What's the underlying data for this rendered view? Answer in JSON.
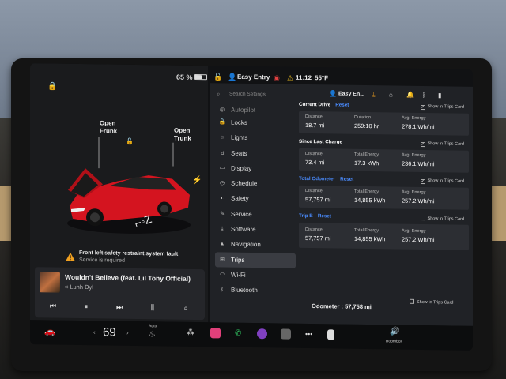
{
  "status": {
    "battery": "65 %",
    "profile": "Easy Entry",
    "time": "11:12",
    "temp": "55°F",
    "profile_short": "Easy En..."
  },
  "car": {
    "open_frunk": [
      "Open",
      "Frunk"
    ],
    "open_trunk": [
      "Open",
      "Trunk"
    ]
  },
  "alert": {
    "title": "Front left safety restraint system fault",
    "subtitle": "Service is required"
  },
  "media": {
    "song": "Wouldn't Believe (feat. Lil Tony Official)",
    "artist": "Luhh Dyl"
  },
  "settings": {
    "search_placeholder": "Search Settings",
    "nav": [
      {
        "label": "Autopilot",
        "icon": "steering-wheel-icon"
      },
      {
        "label": "Locks",
        "icon": "lock-icon"
      },
      {
        "label": "Lights",
        "icon": "light-icon"
      },
      {
        "label": "Seats",
        "icon": "seat-icon"
      },
      {
        "label": "Display",
        "icon": "display-icon"
      },
      {
        "label": "Schedule",
        "icon": "clock-icon"
      },
      {
        "label": "Safety",
        "icon": "shield-icon"
      },
      {
        "label": "Service",
        "icon": "wrench-icon"
      },
      {
        "label": "Software",
        "icon": "download-icon"
      },
      {
        "label": "Navigation",
        "icon": "navigation-icon"
      },
      {
        "label": "Trips",
        "icon": "trips-icon"
      },
      {
        "label": "Wi-Fi",
        "icon": "wifi-icon"
      },
      {
        "label": "Bluetooth",
        "icon": "bluetooth-icon"
      }
    ],
    "active_nav": "Trips",
    "show_in_trips_card": "Show in Trips Card",
    "reset": "Reset",
    "sections": [
      {
        "title": "Current Drive",
        "reset": true,
        "checked": true,
        "stats": [
          {
            "k": "Distance",
            "v": "18.7 mi"
          },
          {
            "k": "Duration",
            "v": "259:10 hr"
          },
          {
            "k": "Avg. Energy",
            "v": "278.1 Wh/mi"
          }
        ]
      },
      {
        "title": "Since Last Charge",
        "reset": false,
        "checked": true,
        "stats": [
          {
            "k": "Distance",
            "v": "73.4 mi"
          },
          {
            "k": "Total Energy",
            "v": "17.3 kWh"
          },
          {
            "k": "Avg. Energy",
            "v": "236.1 Wh/mi"
          }
        ]
      },
      {
        "title": "Total Odometer",
        "reset": true,
        "checked": true,
        "blue": true,
        "stats": [
          {
            "k": "Distance",
            "v": "57,757 mi"
          },
          {
            "k": "Total Energy",
            "v": "14,855 kWh"
          },
          {
            "k": "Avg. Energy",
            "v": "257.2 Wh/mi"
          }
        ]
      },
      {
        "title": "Trip B",
        "reset": true,
        "checked": false,
        "blue": true,
        "stats": [
          {
            "k": "Distance",
            "v": "57,757 mi"
          },
          {
            "k": "Total Energy",
            "v": "14,855 kWh"
          },
          {
            "k": "Avg. Energy",
            "v": "257.2 Wh/mi"
          }
        ]
      }
    ],
    "odometer": "Odometer : 57,758 mi"
  },
  "dock": {
    "temperature": "69",
    "auto_label": "Auto",
    "boombox_label": "Boombox"
  },
  "colors": {
    "accent": "#4a8cff",
    "car": "#e0202a",
    "warning": "#f0a020"
  }
}
